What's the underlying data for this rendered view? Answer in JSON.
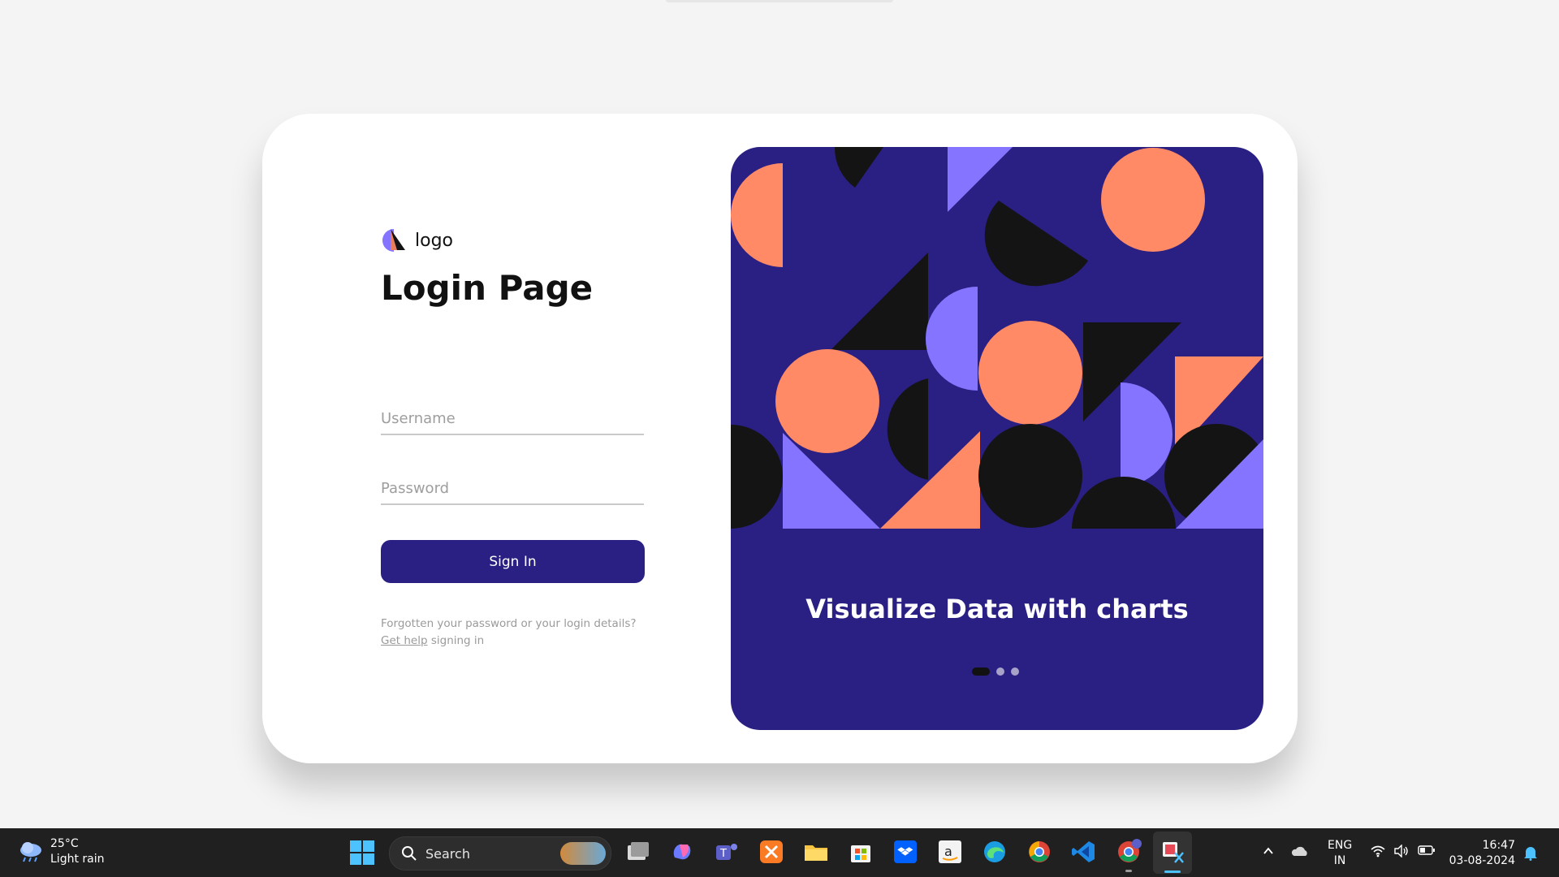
{
  "login": {
    "logo_text": "logo",
    "title": "Login Page",
    "username_placeholder": "Username",
    "password_placeholder": "Password",
    "signin_label": "Sign In",
    "help_text_before": "Forgotten your password or your login details?",
    "help_link_text": "Get help",
    "help_text_after": "signing in"
  },
  "carousel": {
    "caption": "Visualize Data with charts",
    "slide_count": 3,
    "active_slide": 1
  },
  "colors": {
    "primary": "#2a1f82",
    "coral": "#ff8a65",
    "lavender": "#8474ff",
    "black": "#141414"
  },
  "taskbar": {
    "weather_temp": "25°C",
    "weather_desc": "Light rain",
    "search_label": "Search",
    "apps": [
      "windows-start-icon",
      "task-view-icon",
      "copilot-icon",
      "teams-icon",
      "xampp-icon",
      "file-explorer-icon",
      "microsoft-store-icon",
      "dropbox-icon",
      "amazon-icon",
      "edge-icon",
      "chrome-icon",
      "vscode-icon",
      "chrome-profile-icon",
      "snipping-tool-icon"
    ],
    "lang_line1": "ENG",
    "lang_line2": "IN",
    "time": "16:47",
    "date": "03-08-2024"
  }
}
